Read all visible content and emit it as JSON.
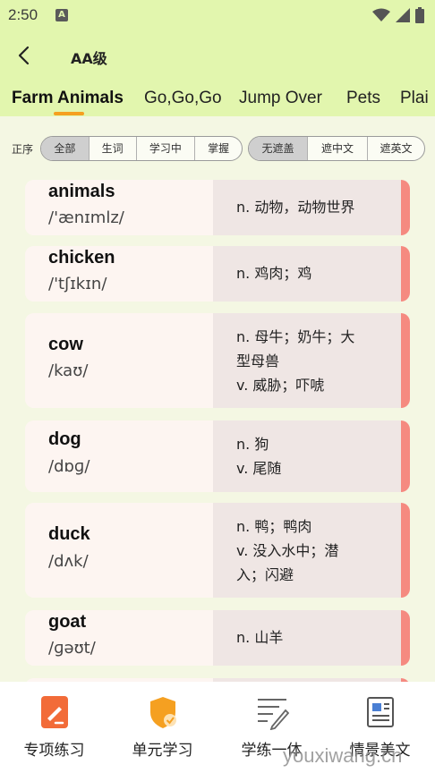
{
  "status": {
    "time": "2:50"
  },
  "header": {
    "title": "AA级"
  },
  "tabs": [
    {
      "label": "Farm Animals"
    },
    {
      "label": "Go,Go,Go"
    },
    {
      "label": "Jump Over"
    },
    {
      "label": "Pets"
    },
    {
      "label": "Plai"
    }
  ],
  "filters": {
    "order_label": "正序",
    "group1": [
      "全部",
      "生词",
      "学习中",
      "掌握"
    ],
    "group1_selected": "全部",
    "group2": [
      "无遮盖",
      "遮中文",
      "遮英文"
    ],
    "group2_selected": "无遮盖"
  },
  "words": [
    {
      "word": "animals",
      "phonetic": "/'ænɪmlz/",
      "defs": [
        "n. 动物，动物世界"
      ]
    },
    {
      "word": "chicken",
      "phonetic": "/'tʃɪkɪn/",
      "defs": [
        "n. 鸡肉；鸡"
      ]
    },
    {
      "word": "cow",
      "phonetic": "/kaʊ/",
      "defs": [
        "n. 母牛；奶牛；大",
        "型母兽",
        "v. 威胁；吓唬"
      ]
    },
    {
      "word": "dog",
      "phonetic": "/dɒɡ/",
      "defs": [
        "n. 狗",
        "v. 尾随"
      ]
    },
    {
      "word": "duck",
      "phonetic": "/dʌk/",
      "defs": [
        "n. 鸭；鸭肉",
        "v. 没入水中；潜",
        "入；闪避"
      ]
    },
    {
      "word": "goat",
      "phonetic": "/ɡəʊt/",
      "defs": [
        "n. 山羊"
      ]
    }
  ],
  "bottom_nav": [
    {
      "label": "专项练习",
      "icon": "pencil-doc-icon"
    },
    {
      "label": "单元学习",
      "icon": "shield-check-icon"
    },
    {
      "label": "学练一体",
      "icon": "notes-pen-icon"
    },
    {
      "label": "情景美文",
      "icon": "newspaper-icon"
    }
  ],
  "watermark": "youxiwang.cn",
  "colors": {
    "top_bg": "#e2f6ae",
    "accent": "#f5a021",
    "card_bar": "#f58a80",
    "nav_orange": "#f26b38"
  }
}
